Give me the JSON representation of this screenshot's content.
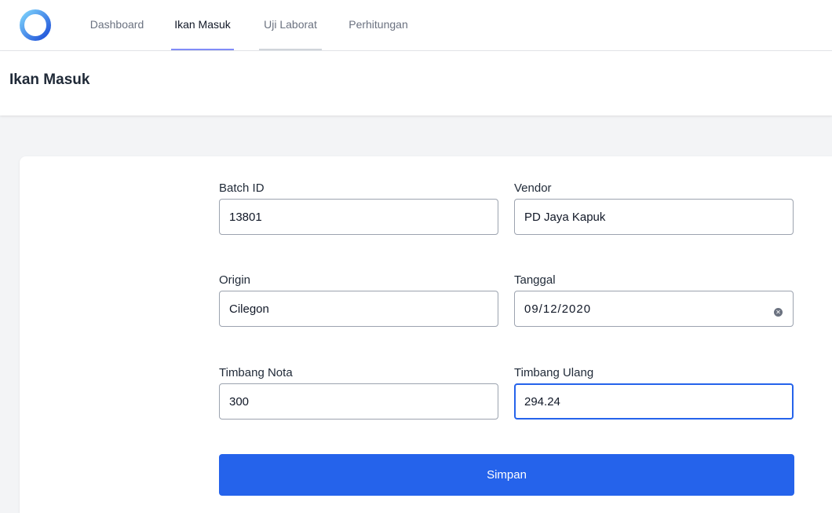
{
  "nav": {
    "items": [
      {
        "label": "Dashboard"
      },
      {
        "label": "Ikan Masuk"
      },
      {
        "label": "Uji Laborat"
      },
      {
        "label": "Perhitungan"
      }
    ]
  },
  "header": {
    "title": "Ikan Masuk"
  },
  "form": {
    "batch_id": {
      "label": "Batch ID",
      "value": "13801"
    },
    "vendor": {
      "label": "Vendor",
      "value": "PD Jaya Kapuk"
    },
    "origin": {
      "label": "Origin",
      "value": "Cilegon"
    },
    "tanggal": {
      "label": "Tanggal",
      "value": "09/12/2020"
    },
    "timbang_nota": {
      "label": "Timbang Nota",
      "value": "300"
    },
    "timbang_ulang": {
      "label": "Timbang Ulang",
      "value": "294.24"
    },
    "submit_label": "Simpan"
  },
  "colors": {
    "accent": "#2563eb",
    "active_tab_underline": "#818cf8"
  },
  "icons": {
    "logo": "ring-logo-icon",
    "date_clear": "clear-circle-icon"
  }
}
